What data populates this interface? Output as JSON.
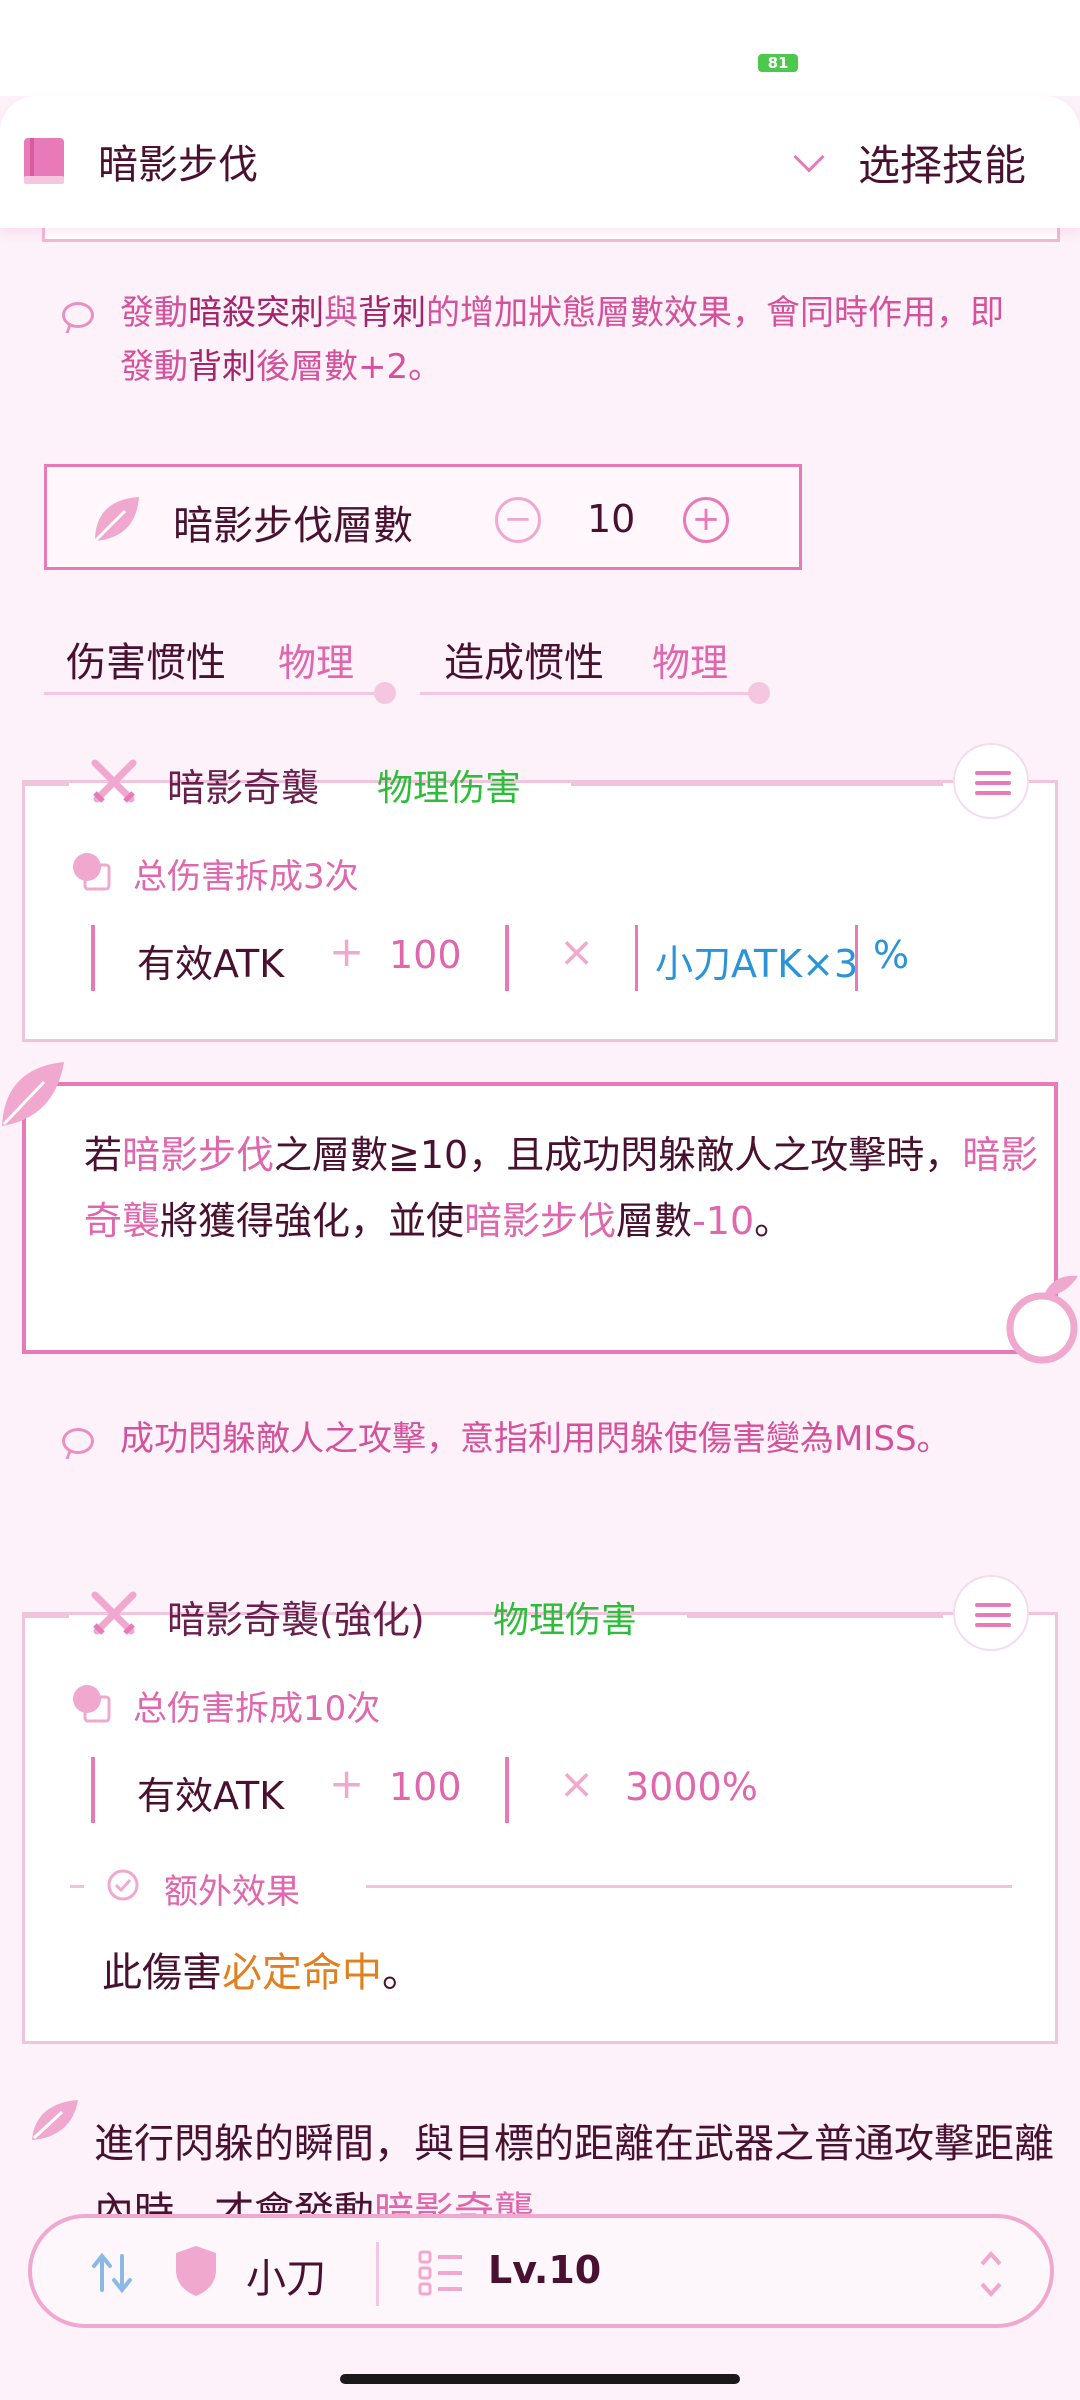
{
  "status_bar": {
    "battery": "81"
  },
  "header": {
    "title": "暗影步伐",
    "action": "选择技能"
  },
  "note1": {
    "parts": [
      "發動",
      "暗殺突刺",
      "與",
      "背刺",
      "的增加狀態層數效果，會同時作用，即發動",
      "背刺",
      "後層數+2。"
    ]
  },
  "stack": {
    "label": "暗影步伐層數",
    "value": "10"
  },
  "props": [
    {
      "label": "伤害惯性",
      "value": "物理"
    },
    {
      "label": "造成惯性",
      "value": "物理"
    }
  ],
  "skill1": {
    "name": "暗影奇襲",
    "damage_type": "物理伤害",
    "hits": "总伤害拆成3次",
    "formula": {
      "base": "有效ATK",
      "plus": "+",
      "add": "100",
      "times": "×",
      "mult": "小刀ATK×3",
      "unit": "%"
    }
  },
  "callout": {
    "parts": [
      "若",
      "暗影步伐",
      "之層數≧10，且成功閃躲敵人之攻擊時，",
      "暗影奇襲",
      "將獲得強化，並使",
      "暗影步伐",
      "層數",
      "-10",
      "。"
    ]
  },
  "note2": {
    "parts": [
      "成功閃躲敵人之攻擊，意指利用閃躲使傷害變為",
      "MISS",
      "。"
    ]
  },
  "skill2": {
    "name": "暗影奇襲(強化)",
    "damage_type": "物理伤害",
    "hits": "总伤害拆成10次",
    "formula": {
      "base": "有效ATK",
      "plus": "+",
      "add": "100",
      "times": "×",
      "mult": "3000%"
    },
    "extra_label": "额外效果",
    "extra": {
      "parts": [
        "此傷害",
        "必定命中",
        "。"
      ]
    }
  },
  "bottom_note": {
    "parts": [
      "進行閃躲的瞬間，與目標的距離在武器之普通攻擊距離內時，才會發動",
      "暗影奇襲",
      "。"
    ]
  },
  "bottom_bar": {
    "weapon": "小刀",
    "level": "Lv.10"
  },
  "colors": {
    "accent": "#e87ab8",
    "pink_text": "#e066ad",
    "green": "#2ebd3a",
    "blue": "#2b94d8",
    "orange": "#e08020"
  }
}
